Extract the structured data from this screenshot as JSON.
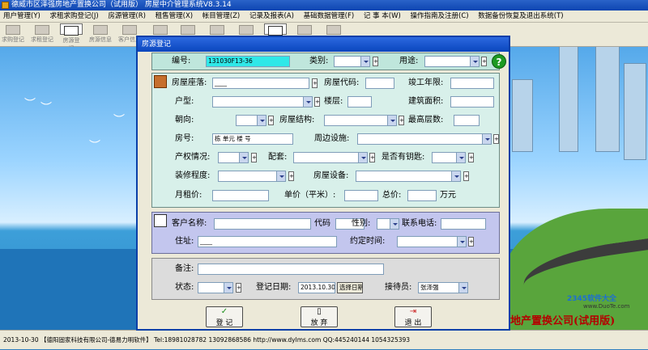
{
  "window": {
    "title": "德威市区泽强房地产置换公司（试用版） 房屋中介管理系统V8.3.14"
  },
  "menu": [
    "用户管理(Y)",
    "求租求购登记(J)",
    "房源管理(R)",
    "租售管理(X)",
    "帐目管理(Z)",
    "记录及报表(A)",
    "基础数据管理(F)",
    "记 事 本(W)",
    "操作指南及注册(C)",
    "数据备份恢复及退出系统(T)"
  ],
  "toolbar": [
    "求购登记",
    "求租登记",
    "房源登记",
    "房源信息",
    "客户信息",
    "",
    "",
    "",
    "",
    "",
    "",
    ""
  ],
  "dialog": {
    "title": "房源登记",
    "top": {
      "number_label": "编号:",
      "number_value": "131030F13-36",
      "category_label": "类别:",
      "category_value": "",
      "usage_label": "用途:",
      "usage_value": ""
    },
    "house": {
      "location_label": "房屋座落:",
      "location_value": "____",
      "code_label": "房屋代码:",
      "code_value": "",
      "year_label": "竣工年限:",
      "year_value": "",
      "type_label": "户型:",
      "type_value": "",
      "floor_label": "楼层:",
      "floor_value": "",
      "area_label": "建筑面积:",
      "area_value": "",
      "orient_label": "朝向:",
      "orient_value": "",
      "struct_label": "房屋结构:",
      "struct_value": "",
      "maxfloor_label": "最高层数:",
      "maxfloor_value": "",
      "room_label": "房号:",
      "room_value": "栋 单元 楼 号",
      "around_label": "周边设施:",
      "around_value": "",
      "prop_label": "产权情况:",
      "prop_value": "",
      "equip_label": "配套:",
      "equip_value": "",
      "key_label": "是否有钥匙:",
      "key_value": "",
      "decor_label": "装修程度:",
      "decor_value": "",
      "fac_label": "房屋设备:",
      "fac_value": "",
      "rent_label": "月租价:",
      "rent_value": "",
      "unit_label": "单价（平米）:",
      "unit_value": "",
      "total_label": "总价:",
      "total_value": "",
      "total_unit": "万元"
    },
    "customer": {
      "name_label": "客户名称:",
      "name_value": "",
      "code_label": "代码",
      "code_value": "",
      "sex_label": "性别:",
      "sex_value": "",
      "phone_label": "联系电话:",
      "phone_value": "",
      "addr_label": "住址:",
      "addr_value": "____",
      "appoint_label": "约定时间:",
      "appoint_value": ""
    },
    "misc": {
      "note_label": "备注:",
      "note_value": "",
      "status_label": "状态:",
      "status_value": "",
      "date_label": "登记日期:",
      "date_value": "2013.10.30",
      "date_btn": "选择日期",
      "agent_label": "接待员:",
      "agent_value": "张泽强"
    },
    "buttons": {
      "register": "登 记",
      "discard": "放 弃",
      "exit": "退 出"
    }
  },
  "statusbar": {
    "text": "2013-10-30 【德阳固家科技有限公司-德易力明软件】 Tel:18981028782 13092868586 http://www.dylms.com QQ:445240144 1054325393"
  },
  "overlay": {
    "watermark": "地产置换公司(试用版)",
    "logo": "2345软件大全",
    "logo_url": "www.DuoTe.com"
  },
  "colors": {
    "titlebar": "#0d45b1",
    "panel_teal": "#d8f0ea",
    "panel_purple": "#c3c6ee",
    "number_field": "#2fe8e8"
  }
}
